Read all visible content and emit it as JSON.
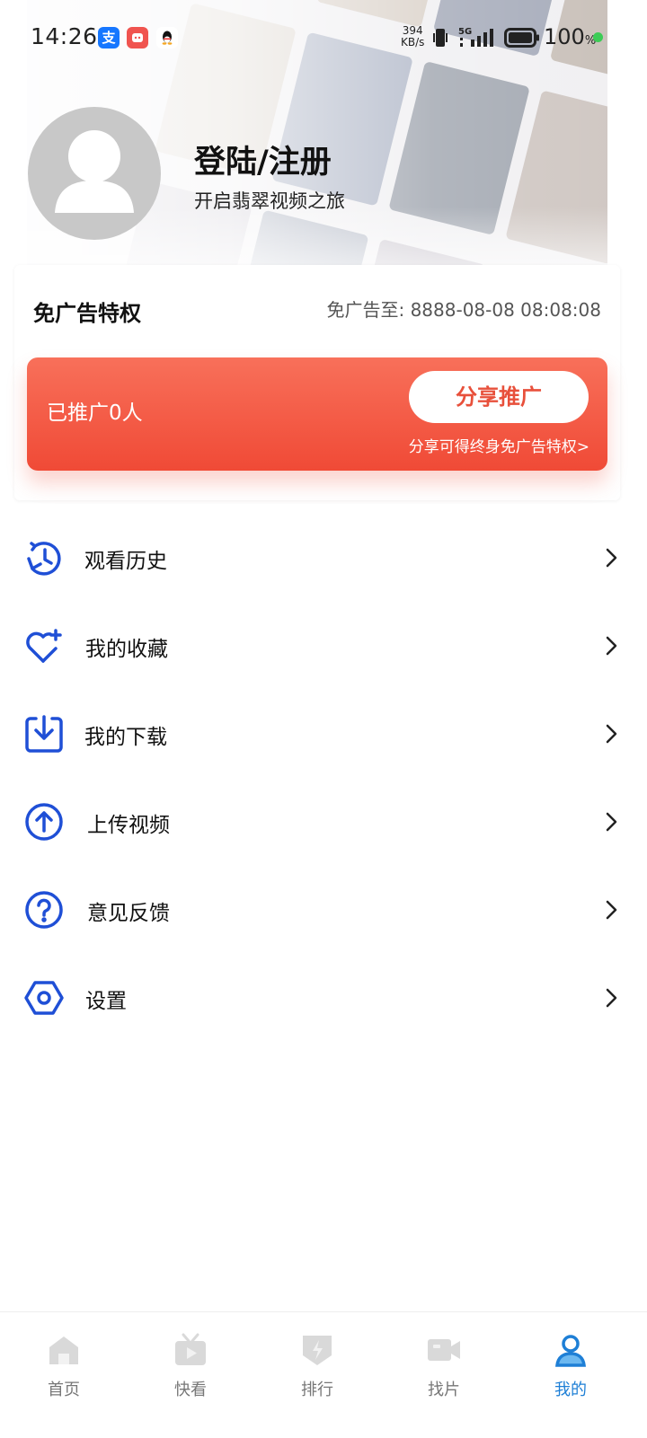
{
  "status_bar": {
    "time": "14:26",
    "net_speed_value": "394",
    "net_speed_unit": "KB/s",
    "network_type": "5G",
    "battery": "100",
    "battery_unit": "%"
  },
  "profile": {
    "title": "登陆/注册",
    "subtitle": "开启翡翠视频之旅"
  },
  "ad_free": {
    "title": "免广告特权",
    "expiry": "免广告至: 8888-08-08 08:08:08",
    "promoted_count": "已推广0人",
    "share_button": "分享推广",
    "share_hint": "分享可得终身免广告特权>"
  },
  "menu": {
    "items": [
      {
        "label": "观看历史",
        "icon": "history-icon"
      },
      {
        "label": "我的收藏",
        "icon": "favorite-heart-icon"
      },
      {
        "label": "我的下载",
        "icon": "download-icon"
      },
      {
        "label": "上传视频",
        "icon": "upload-icon"
      },
      {
        "label": "意见反馈",
        "icon": "question-icon"
      },
      {
        "label": "设置",
        "icon": "settings-icon"
      }
    ]
  },
  "bottom_nav": {
    "items": [
      {
        "label": "首页",
        "icon": "home-icon"
      },
      {
        "label": "快看",
        "icon": "tv-play-icon"
      },
      {
        "label": "排行",
        "icon": "rank-icon"
      },
      {
        "label": "找片",
        "icon": "video-camera-icon"
      },
      {
        "label": "我的",
        "icon": "user-icon",
        "active": true
      }
    ]
  },
  "colors": {
    "accent": "#1e7fd6",
    "menu_icon": "#1f4fd6",
    "promo_gradient_top": "#f8705a",
    "promo_gradient_bottom": "#f04a36",
    "promo_button_text": "#e8503b"
  }
}
